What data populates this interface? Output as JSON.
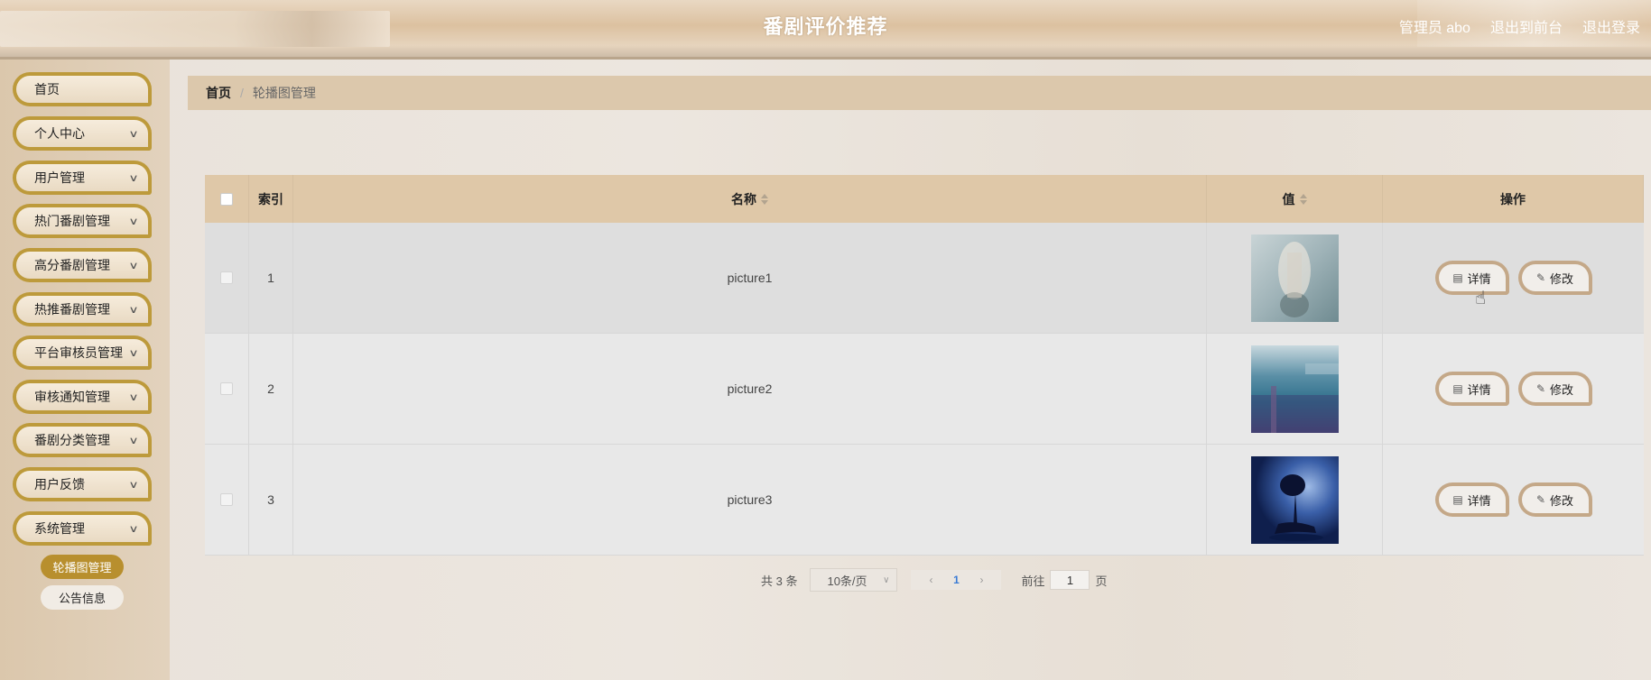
{
  "header": {
    "title": "番剧评价推荐",
    "admin_label": "管理员 abo",
    "to_front": "退出到前台",
    "logout": "退出登录"
  },
  "sidebar": {
    "items": [
      {
        "label": "首页",
        "has_children": false
      },
      {
        "label": "个人中心",
        "has_children": true
      },
      {
        "label": "用户管理",
        "has_children": true
      },
      {
        "label": "热门番剧管理",
        "has_children": true
      },
      {
        "label": "高分番剧管理",
        "has_children": true
      },
      {
        "label": "热推番剧管理",
        "has_children": true
      },
      {
        "label": "平台审核员管理",
        "has_children": true
      },
      {
        "label": "审核通知管理",
        "has_children": true
      },
      {
        "label": "番剧分类管理",
        "has_children": true
      },
      {
        "label": "用户反馈",
        "has_children": true
      },
      {
        "label": "系统管理",
        "has_children": true
      }
    ],
    "sub_items": [
      {
        "label": "轮播图管理",
        "active": true
      },
      {
        "label": "公告信息",
        "active": false
      }
    ]
  },
  "breadcrumb": {
    "home": "首页",
    "separator": "/",
    "current": "轮播图管理"
  },
  "table": {
    "headers": {
      "index": "索引",
      "name": "名称",
      "value": "值",
      "ops": "操作"
    },
    "rows": [
      {
        "index": "1",
        "name": "picture1",
        "image": "blurred-figure"
      },
      {
        "index": "2",
        "name": "picture2",
        "image": "seascape-pier"
      },
      {
        "index": "3",
        "name": "picture3",
        "image": "tree-moon"
      }
    ],
    "detail_label": "详情",
    "edit_label": "修改"
  },
  "pagination": {
    "total": "共 3 条",
    "page_size": "10条/页",
    "current_page": "1",
    "goto_prefix": "前往",
    "goto_value": "1",
    "goto_suffix": "页"
  },
  "colors": {
    "accent": "#bd9a3b",
    "header_bg": "#dcc1a0",
    "table_header_bg": "#dfc8a8",
    "active_sub": "#b88f2e"
  }
}
